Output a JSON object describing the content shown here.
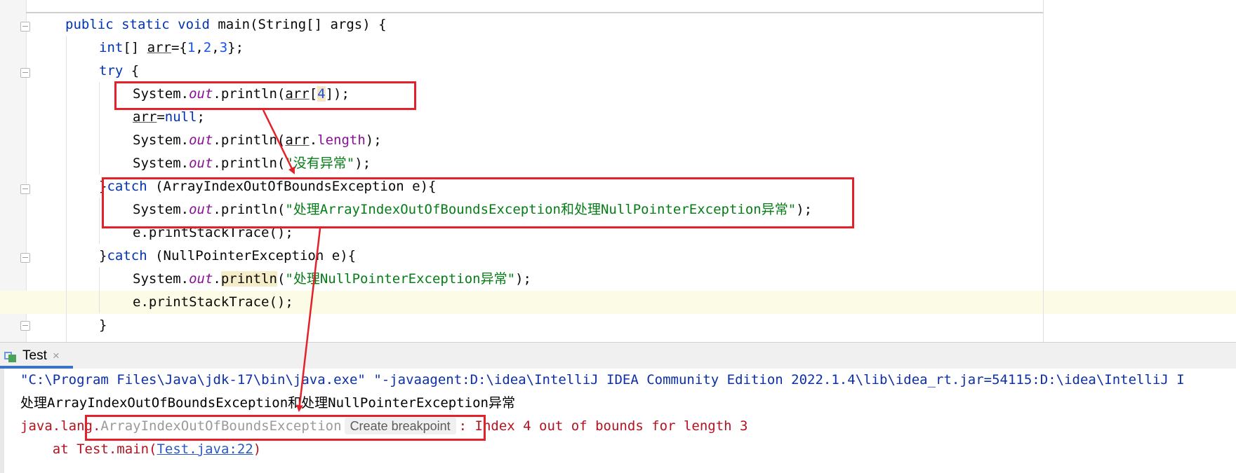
{
  "editor": {
    "lines": [
      {
        "parts": [
          [
            "kw",
            "public static void "
          ],
          [
            "plain",
            "main(String[] args) {"
          ]
        ]
      },
      {
        "parts": [
          [
            "kw",
            "int"
          ],
          [
            "plain",
            "[] "
          ],
          [
            "ul",
            "arr"
          ],
          [
            "plain",
            "={"
          ],
          [
            "num",
            "1"
          ],
          [
            "plain",
            ","
          ],
          [
            "num",
            "2"
          ],
          [
            "plain",
            ","
          ],
          [
            "num",
            "3"
          ],
          [
            "plain",
            "};"
          ]
        ]
      },
      {
        "parts": [
          [
            "kw",
            "try"
          ],
          [
            "plain",
            " {"
          ]
        ]
      },
      {
        "parts": [
          [
            "plain",
            "System."
          ],
          [
            "fld",
            "out"
          ],
          [
            "plain",
            ".println("
          ],
          [
            "ul",
            "arr"
          ],
          [
            "plain",
            "["
          ],
          [
            "numhl",
            "4"
          ],
          [
            "plain",
            "]);"
          ]
        ]
      },
      {
        "parts": [
          [
            "ul",
            "arr"
          ],
          [
            "plain",
            "="
          ],
          [
            "kw",
            "null"
          ],
          [
            "plain",
            ";"
          ]
        ]
      },
      {
        "parts": [
          [
            "plain",
            "System."
          ],
          [
            "fld",
            "out"
          ],
          [
            "plain",
            ".println("
          ],
          [
            "ul",
            "arr"
          ],
          [
            "plain",
            "."
          ],
          [
            "mem",
            "length"
          ],
          [
            "plain",
            ");"
          ]
        ]
      },
      {
        "parts": [
          [
            "plain",
            "System."
          ],
          [
            "fld",
            "out"
          ],
          [
            "plain",
            ".println("
          ],
          [
            "str",
            "\"没有异常\""
          ],
          [
            "plain",
            ");"
          ]
        ]
      },
      {
        "parts": [
          [
            "plain",
            "}"
          ],
          [
            "kw",
            "catch"
          ],
          [
            "plain",
            " (ArrayIndexOutOfBoundsException e){"
          ]
        ]
      },
      {
        "parts": [
          [
            "plain",
            "System."
          ],
          [
            "fld",
            "out"
          ],
          [
            "plain",
            ".println("
          ],
          [
            "str",
            "\"处理ArrayIndexOutOfBoundsException和处理NullPointerException异常\""
          ],
          [
            "plain",
            ");"
          ]
        ]
      },
      {
        "parts": [
          [
            "plain",
            "e.printStackTrace();"
          ]
        ]
      },
      {
        "parts": [
          [
            "plain",
            "}"
          ],
          [
            "kw",
            "catch"
          ],
          [
            "plain",
            " (NullPointerException e){"
          ]
        ]
      },
      {
        "parts": [
          [
            "plain",
            "System."
          ],
          [
            "fld",
            "out"
          ],
          [
            "plain",
            "."
          ],
          [
            "hl",
            "println"
          ],
          [
            "plain",
            "("
          ],
          [
            "str",
            "\"处理NullPointerException异常\""
          ],
          [
            "plain",
            ");"
          ]
        ]
      },
      {
        "parts": [
          [
            "plain",
            "e.printStackTrace();"
          ]
        ]
      },
      {
        "parts": [
          [
            "plain",
            "}"
          ]
        ]
      }
    ]
  },
  "run_panel": {
    "tab_label": "Test",
    "tab_close": "×",
    "cmd_line": "\"C:\\Program Files\\Java\\jdk-17\\bin\\java.exe\" \"-javaagent:D:\\idea\\IntelliJ IDEA Community Edition 2022.1.4\\lib\\idea_rt.jar=54115:D:\\idea\\IntelliJ I",
    "output_line": "处理ArrayIndexOutOfBoundsException和处理NullPointerException异常",
    "exception_prefix": "java.lang.",
    "exception_class": "ArrayIndexOutOfBoundsException",
    "create_breakpoint": "Create breakpoint",
    "exception_message": ": Index 4 out of bounds for length 3",
    "stack_prefix": "    at Test.main(",
    "stack_link": "Test.java:22",
    "stack_suffix": ")"
  },
  "colors": {
    "keyword": "#0033b3",
    "number": "#1750eb",
    "string": "#067d17",
    "field": "#871094",
    "error": "#b3121f",
    "annotation_red": "#e4202a"
  }
}
